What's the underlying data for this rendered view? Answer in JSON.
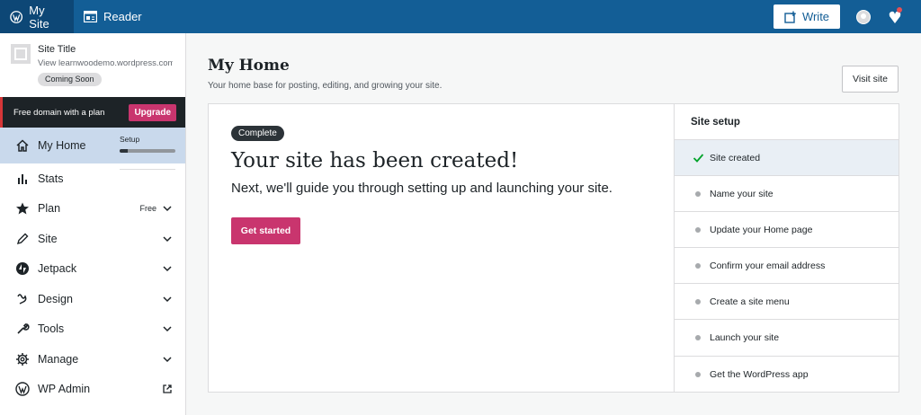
{
  "masterbar": {
    "my_site": "My Site",
    "reader": "Reader",
    "write": "Write"
  },
  "sidebar": {
    "site_title": "Site Title",
    "site_url": "View learnwoodemo.wordpress.com",
    "coming_soon": "Coming Soon",
    "upsell_text": "Free domain with a plan",
    "upgrade": "Upgrade",
    "setup_label": "Setup",
    "setup_progress": 0.15,
    "plan_badge": "Free",
    "items": [
      {
        "label": "My Home",
        "icon": "home-icon"
      },
      {
        "label": "Stats",
        "icon": "stats-icon"
      },
      {
        "label": "Plan",
        "icon": "star-icon"
      },
      {
        "label": "Site",
        "icon": "pencil-icon"
      },
      {
        "label": "Jetpack",
        "icon": "jetpack-icon"
      },
      {
        "label": "Design",
        "icon": "design-icon"
      },
      {
        "label": "Tools",
        "icon": "wrench-icon"
      },
      {
        "label": "Manage",
        "icon": "gear-icon"
      },
      {
        "label": "WP Admin",
        "icon": "wordpress-icon"
      }
    ]
  },
  "main": {
    "title": "My Home",
    "subtitle": "Your home base for posting, editing, and growing your site.",
    "visit_site": "Visit site",
    "hero": {
      "badge": "Complete",
      "title": "Your site has been created!",
      "subtitle": "Next, we'll guide you through setting up and launching your site.",
      "cta": "Get started"
    },
    "site_setup": {
      "heading": "Site setup",
      "tasks": [
        {
          "label": "Site created",
          "done": true
        },
        {
          "label": "Name your site",
          "done": false
        },
        {
          "label": "Update your Home page",
          "done": false
        },
        {
          "label": "Confirm your email address",
          "done": false
        },
        {
          "label": "Create a site menu",
          "done": false
        },
        {
          "label": "Launch your site",
          "done": false
        },
        {
          "label": "Get the WordPress app",
          "done": false
        }
      ]
    }
  },
  "colors": {
    "masterbar": "#135e96",
    "accent_pink": "#c9356e",
    "active_nav": "#c9d9ec",
    "check_green": "#00a32a"
  }
}
